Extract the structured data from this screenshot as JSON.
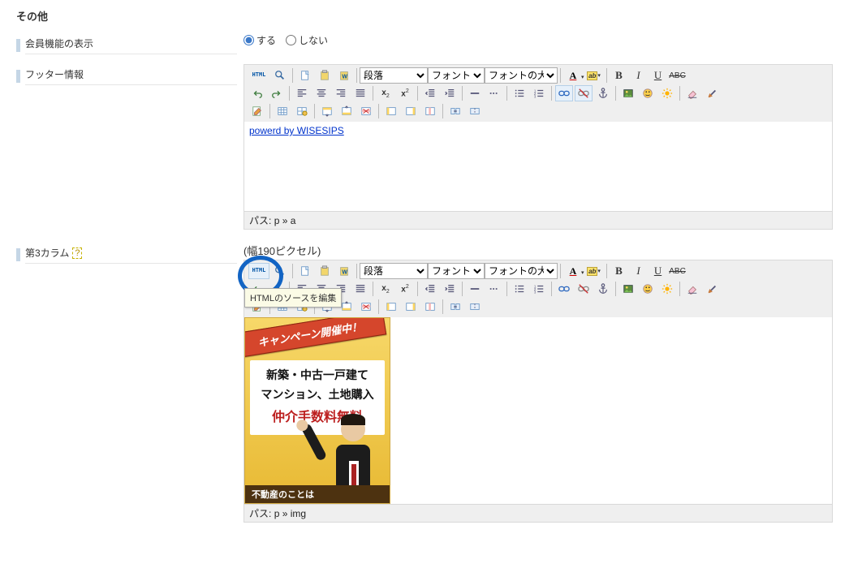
{
  "section": {
    "heading": "その他"
  },
  "fields": {
    "member_display": {
      "label": "会員機能の表示",
      "option_do": "する",
      "option_dont": "しない",
      "selected": "する"
    },
    "footer_info": {
      "label": "フッター情報"
    },
    "third_col": {
      "label": "第3カラム",
      "caption": "(幅190ピクセル)"
    }
  },
  "editor": {
    "format_sel": "段落",
    "font_sel": "フォント",
    "size_sel": "フォントの大き",
    "html_btn": "HTML",
    "path_label": "パス:",
    "tooltip": "HTMLのソースを編集"
  },
  "editor1": {
    "content_link": "powerd by WISESIPS",
    "path": "p » a"
  },
  "editor2": {
    "path": "p » img"
  },
  "banner": {
    "ribbon": "キャンペーン開催中！",
    "line1a": "新築・中古一戸建て",
    "line1b": "マンション、土地購入",
    "line2": "仲介手数料無料",
    "footer": "不動産のことは"
  }
}
